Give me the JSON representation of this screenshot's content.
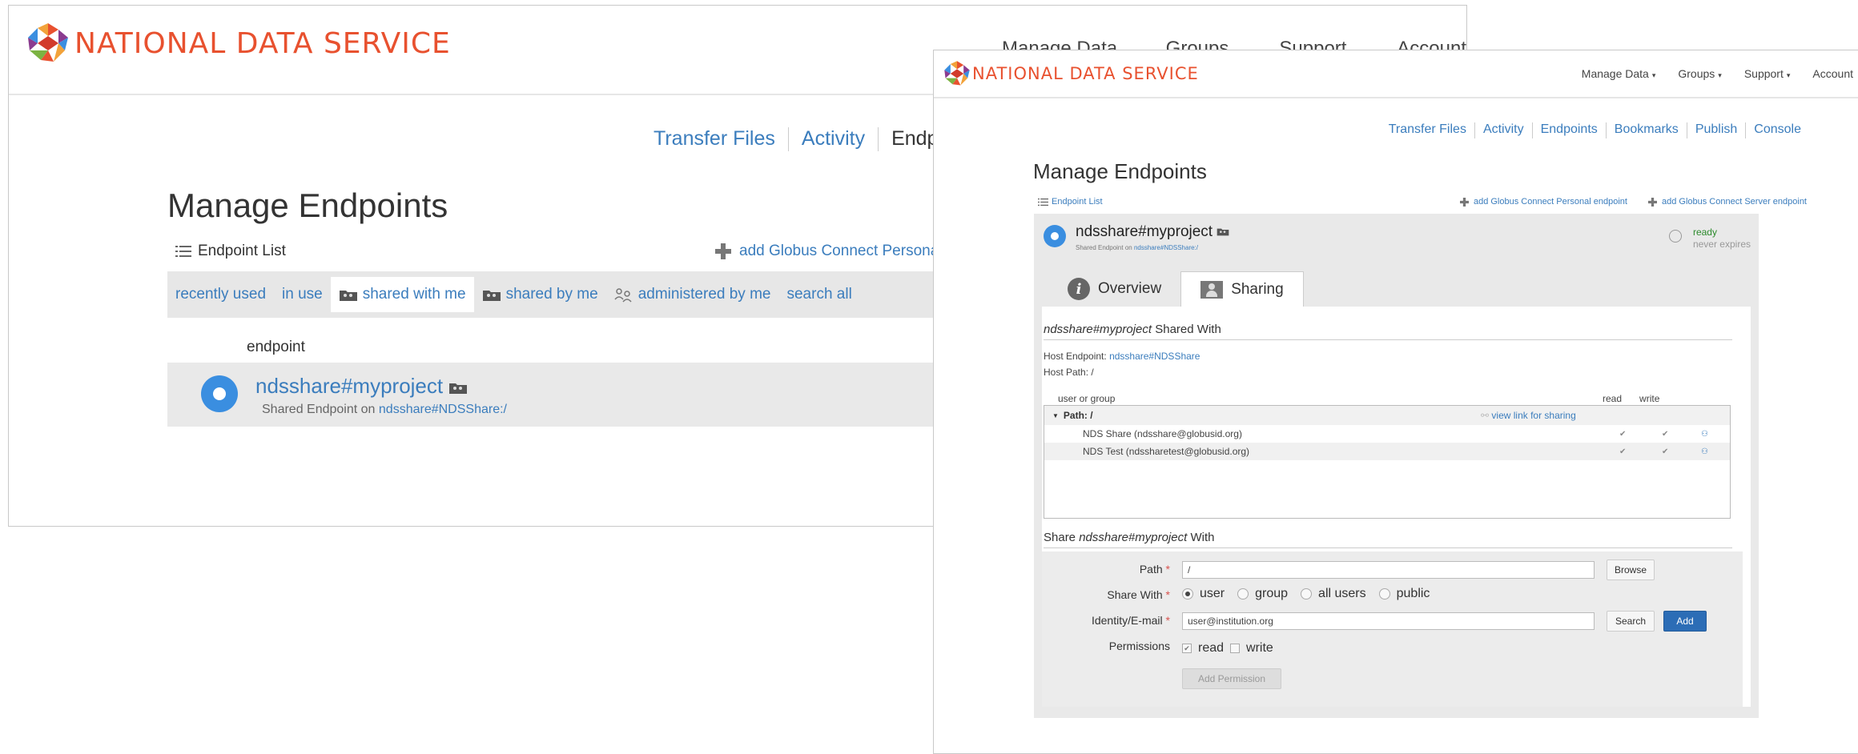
{
  "back": {
    "brand": "NATIONAL DATA SERVICE",
    "topnav": [
      "Manage Data ▾",
      "Groups ▾",
      "Support ▾",
      "Account"
    ],
    "subnav": [
      "Transfer Files",
      "Activity",
      "Endpoints"
    ],
    "page_title": "Manage Endpoints",
    "endpoint_list": "Endpoint List",
    "add_link": "add Globus Connect Personal endpoint",
    "filters": [
      "recently used",
      "in use",
      "shared with me",
      "shared by me",
      "administered by me",
      "search all"
    ],
    "column_header": "endpoint",
    "endpoint": {
      "name": "ndsshare#myproject",
      "sub_prefix": "Shared Endpoint on ",
      "sub_link": "ndsshare#NDSShare:/"
    }
  },
  "front": {
    "brand": "NATIONAL DATA SERVICE",
    "topnav": [
      "Manage Data",
      "Groups",
      "Support",
      "Account"
    ],
    "subnav": [
      "Transfer Files",
      "Activity",
      "Endpoints",
      "Bookmarks",
      "Publish",
      "Console"
    ],
    "page_title": "Manage Endpoints",
    "endpoint_list": "Endpoint List",
    "add_personal": "add Globus Connect Personal endpoint",
    "add_server": "add Globus Connect Server endpoint",
    "endpoint": {
      "name": "ndsshare#myproject",
      "sub_prefix": "Shared Endpoint on ",
      "sub_link": "ndsshare#NDSShare:/",
      "status": "ready",
      "expires": "never expires"
    },
    "tabs": [
      "Overview",
      "Sharing"
    ],
    "shared_with": {
      "name": "ndsshare#myproject",
      "suffix": " Shared With"
    },
    "host_endpoint_label": "Host Endpoint: ",
    "host_endpoint": "ndsshare#NDSShare",
    "host_path_label": "Host Path: ",
    "host_path": "/",
    "table_headers": {
      "user_or_group": "user or group",
      "read": "read",
      "write": "write"
    },
    "path_row": {
      "label": "Path: /",
      "link": "view link for sharing"
    },
    "users": [
      {
        "name": "NDS Share (ndsshare@globusid.org)"
      },
      {
        "name": "NDS Test (ndssharetest@globusid.org)"
      }
    ],
    "share_prefix": "Share ",
    "share_name": "ndsshare#myproject",
    "share_suffix": " With",
    "form": {
      "path_label": "Path",
      "path_value": "/",
      "browse": "Browse",
      "share_with_label": "Share With",
      "share_options": [
        "user",
        "group",
        "all users",
        "public"
      ],
      "identity_label": "Identity/E-mail",
      "identity_value": "user@institution.org",
      "search": "Search",
      "add": "Add",
      "permissions_label": "Permissions",
      "perm_read": "read",
      "perm_write": "write",
      "add_permission": "Add Permission"
    }
  },
  "colors": {
    "brand": "#e8512f",
    "link": "#3b7dbd",
    "primary": "#2c6db6",
    "endpoint_dot": "#3a8ee0"
  }
}
